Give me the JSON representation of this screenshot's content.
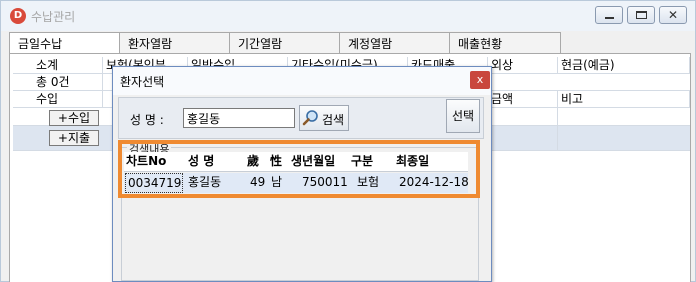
{
  "window": {
    "title": "수납관리",
    "icon_letter": "D",
    "buttons": [
      "minimize",
      "maximize",
      "close"
    ]
  },
  "tabs": [
    {
      "label": "금일수납",
      "active": true
    },
    {
      "label": "환자열람",
      "active": false
    },
    {
      "label": "기간열람",
      "active": false
    },
    {
      "label": "계정열람",
      "active": false
    },
    {
      "label": "매출현황",
      "active": false
    }
  ],
  "grid": {
    "row1": [
      "소계",
      "보험(본인부",
      "일반수입",
      "기타수입(미수금)",
      "카드매출",
      "외상",
      "현금(예금)"
    ],
    "row2_label": "총 0건",
    "row3_label": "수입",
    "row3_c6": "금액",
    "row3_c7": "비고",
    "add_income_label": "+수입",
    "add_expense_label": "+지출"
  },
  "dialog": {
    "title": "환자선택",
    "close_glyph": "x",
    "name_label": "성 명 :",
    "name_value": "홍길동",
    "search_label": "검색",
    "select_label": "선택",
    "results_label": "검색내용",
    "columns": [
      "차트No",
      "성 명",
      "歲",
      "性",
      "생년월일",
      "구분",
      "최종일"
    ],
    "rows": [
      [
        "0034719",
        "홍길동",
        "49",
        "남",
        "750011",
        "보험",
        "2024-12-18"
      ]
    ]
  },
  "colors": {
    "highlight": "#ef8a31",
    "selected_row": "#e0e9f6",
    "close_red": "#c9463d"
  }
}
